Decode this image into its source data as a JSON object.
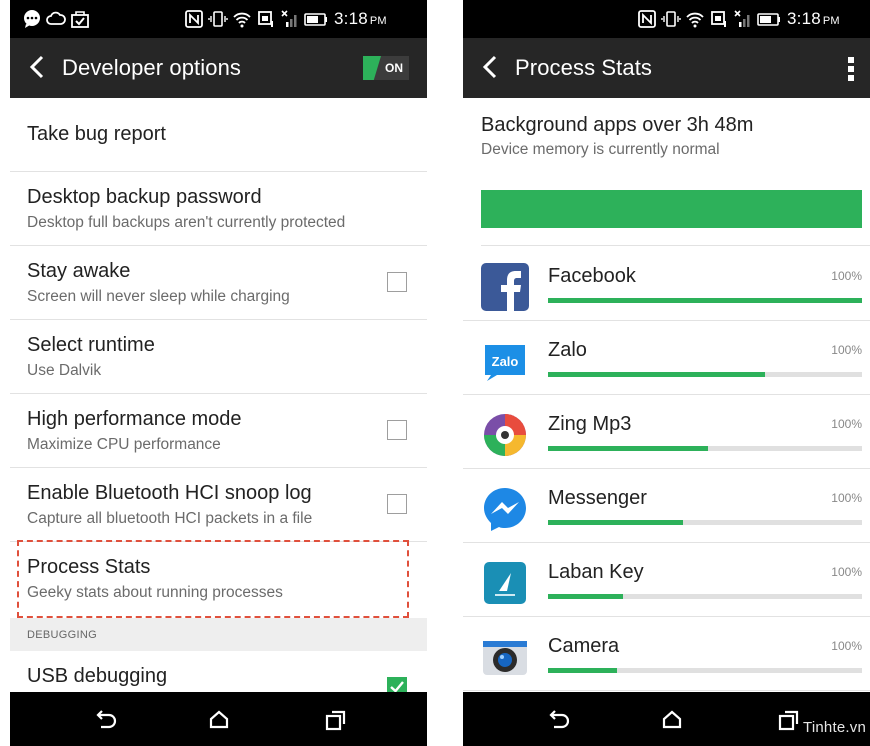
{
  "left": {
    "status_time": "3:18",
    "status_ampm": "PM",
    "title": "Developer options",
    "toggle_label": "ON",
    "items": [
      {
        "title": "Take bug report",
        "subtitle": ""
      },
      {
        "title": "Desktop backup password",
        "subtitle": "Desktop full backups aren't currently protected"
      },
      {
        "title": "Stay awake",
        "subtitle": "Screen will never sleep while charging",
        "checked": false
      },
      {
        "title": "Select runtime",
        "subtitle": "Use Dalvik"
      },
      {
        "title": "High performance mode",
        "subtitle": "Maximize CPU performance",
        "checked": false
      },
      {
        "title": "Enable Bluetooth HCI snoop log",
        "subtitle": "Capture all bluetooth HCI packets in a file",
        "checked": false
      },
      {
        "title": "Process Stats",
        "subtitle": "Geeky stats about running processes"
      },
      {
        "title": "USB debugging",
        "subtitle": "",
        "checked": true
      }
    ],
    "section_header": "DEBUGGING"
  },
  "right": {
    "status_time": "3:18",
    "status_ampm": "PM",
    "title": "Process Stats",
    "background_title": "Background apps over 3h 48m",
    "memory_status": "Device memory is currently normal",
    "memory_level": 1.0,
    "apps": [
      {
        "name": "Facebook",
        "percent": "100%",
        "bar": 1.0,
        "icon": "facebook-icon"
      },
      {
        "name": "Zalo",
        "percent": "100%",
        "bar": 0.69,
        "icon": "zalo-icon",
        "icon_text": "Zalo"
      },
      {
        "name": "Zing Mp3",
        "percent": "100%",
        "bar": 0.51,
        "icon": "zing-mp3-icon"
      },
      {
        "name": "Messenger",
        "percent": "100%",
        "bar": 0.43,
        "icon": "messenger-icon"
      },
      {
        "name": "Laban Key",
        "percent": "100%",
        "bar": 0.24,
        "icon": "laban-key-icon"
      },
      {
        "name": "Camera",
        "percent": "100%",
        "bar": 0.22,
        "icon": "camera-icon"
      }
    ]
  },
  "watermark": "Tinhte.vn",
  "colors": {
    "accent": "#2db15a",
    "highlight": "#e0503c",
    "action_bar": "#262626"
  }
}
